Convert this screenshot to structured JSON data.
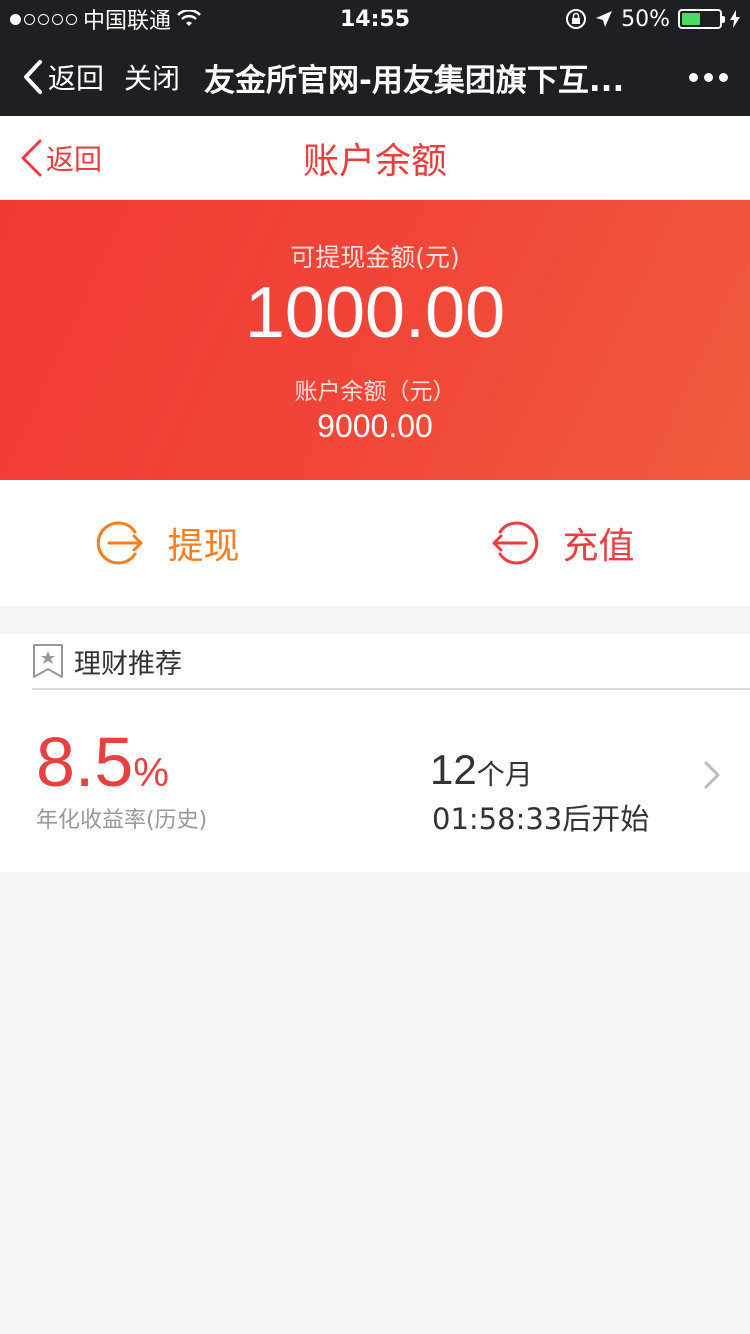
{
  "status_bar": {
    "carrier": "中国联通",
    "time": "14:55",
    "battery": "50%",
    "battery_level": 0.5
  },
  "wechat_bar": {
    "back_label": "返回",
    "close_label": "关闭",
    "title": "友金所官网-用友集团旗下互..."
  },
  "nav": {
    "back_label": "返回",
    "title": "账户余额"
  },
  "hero": {
    "withdrawable_label": "可提现金额(元)",
    "withdrawable_amount": "1000.00",
    "balance_label": "账户余额（元）",
    "balance_amount": "9000.00"
  },
  "actions": {
    "withdraw_label": "提现",
    "recharge_label": "充值",
    "withdraw_color": "#f47e20",
    "recharge_color": "#e84040"
  },
  "recommend": {
    "header": "理财推荐",
    "rate_value": "8.5",
    "rate_unit": "%",
    "rate_label": "年化收益率(历史)",
    "term_value": "12",
    "term_unit": "个月",
    "start_text": "01:58:33后开始"
  },
  "colors": {
    "accent": "#ee3b3b",
    "hero_start": "#f23a35",
    "hero_end": "#f15c3d"
  }
}
